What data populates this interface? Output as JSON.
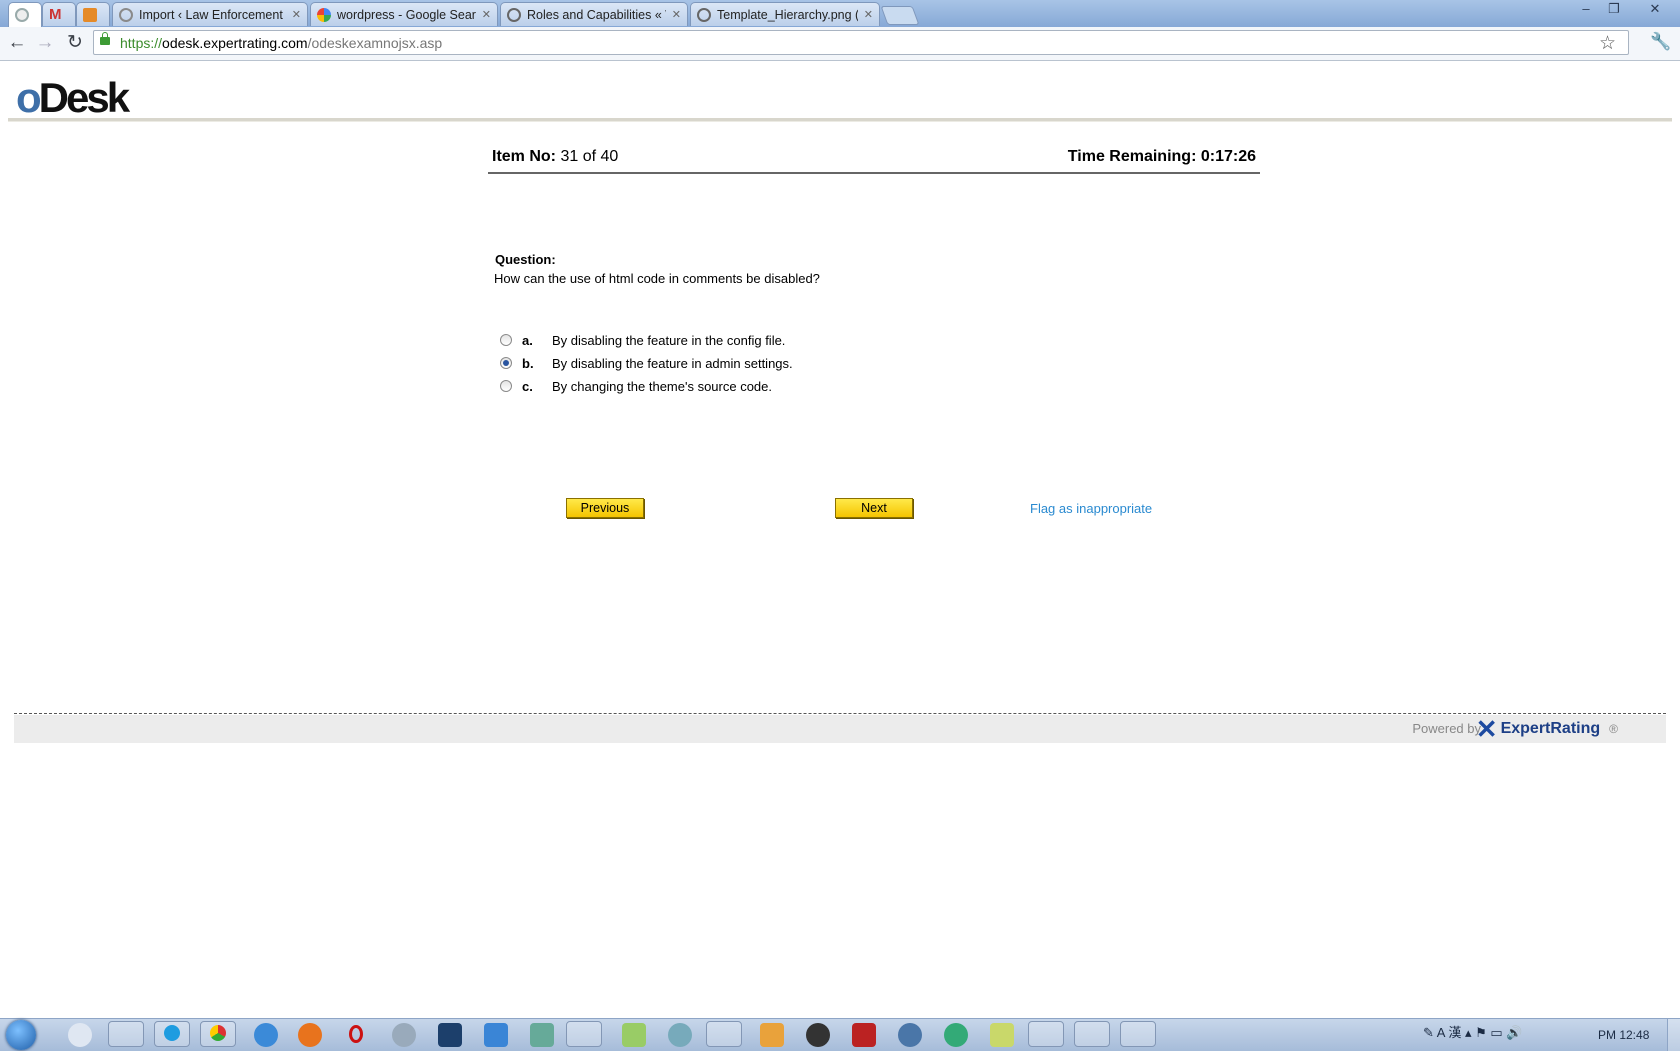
{
  "browser": {
    "tabs": [
      {
        "title": "",
        "icon": "chrome-globe-icon",
        "active": true
      },
      {
        "title": "",
        "icon": "gmail-icon"
      },
      {
        "title": "",
        "icon": "mail-icon"
      },
      {
        "title": "Import ‹ Law Enforcement",
        "icon": "globe-icon"
      },
      {
        "title": "wordpress - Google Search",
        "icon": "google-icon"
      },
      {
        "title": "Roles and Capabilities « W",
        "icon": "wordpress-icon"
      },
      {
        "title": "Template_Hierarchy.png (",
        "icon": "wordpress-icon"
      }
    ],
    "url": {
      "scheme": "https://",
      "host": "odesk.expertrating.com",
      "path": "/odeskexamnojsx.asp"
    }
  },
  "page": {
    "logo": {
      "o": "o",
      "rest": "Desk"
    },
    "item_label": "Item No:",
    "item_value": "31 of 40",
    "time_remaining": "Time Remaining: 0:17:26",
    "question_label": "Question:",
    "question_text": "How can the use of html code in comments be disabled?",
    "options": [
      {
        "letter": "a.",
        "text": "By disabling the feature in the config file.",
        "selected": false
      },
      {
        "letter": "b.",
        "text": "By disabling the feature in admin settings.",
        "selected": true
      },
      {
        "letter": "c.",
        "text": "By changing the theme's source code.",
        "selected": false
      }
    ],
    "previous_label": "Previous",
    "next_label": "Next",
    "flag_label": "Flag as inappropriate",
    "footer": {
      "powered_by": "Powered by",
      "brand": "ExpertRating",
      "reg": "®"
    }
  },
  "taskbar": {
    "clock": "PM 12:48"
  }
}
